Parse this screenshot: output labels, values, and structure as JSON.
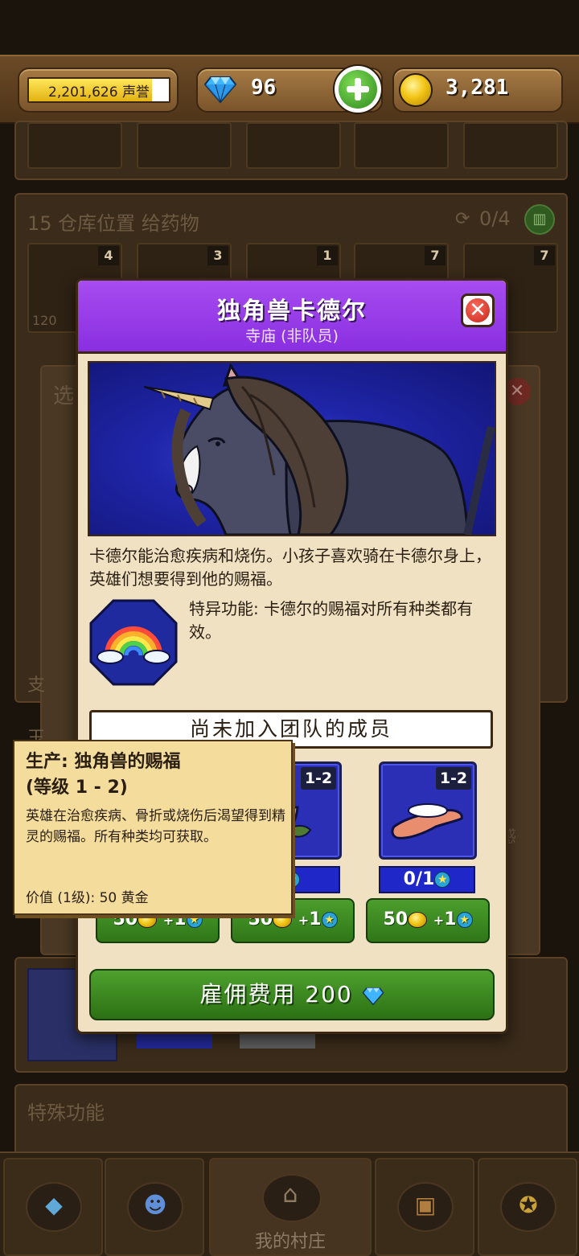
{
  "topbar": {
    "fame_value": "2,201,626 声誉",
    "fame_fill_fraction": 0.88,
    "gems": "96",
    "gold": "3,281"
  },
  "background": {
    "warehouse_title": "15 仓库位置 给药物",
    "warehouse_counter": "0/4",
    "slot_quantities": [
      "4",
      "3",
      "1",
      "7",
      "7"
    ],
    "price_fragment": "120",
    "selection_fragment": "选",
    "side_fragment_1": "支",
    "side_fragment_2": "玉",
    "right_fragment": "感",
    "special_title": "特殊功能",
    "nav_village": "我的村庄"
  },
  "modal": {
    "title": "独角兽卡德尔",
    "subtitle": "寺庙 (非队员)",
    "description": "卡德尔能治愈疾病和烧伤。小孩子喜欢骑在卡德尔身上，英雄们想要得到他的赐福。",
    "ability": "特异功能: 卡德尔的赐福对所有种类都有效。",
    "members_banner": "尚未加入团队的成员",
    "items": [
      {
        "level": "1-2",
        "count": "",
        "cost": "50",
        "cost_star": "1"
      },
      {
        "level": "1-2",
        "count": "",
        "cost": "50",
        "cost_star": "1"
      },
      {
        "level": "1-2",
        "count": "0/1",
        "cost": "50",
        "cost_star": "1"
      }
    ],
    "hire_label": "雇佣费用 200"
  },
  "tooltip": {
    "title_line1": "生产: 独角兽的赐福",
    "title_line2": "(等级 1 - 2)",
    "body": "英雄在治愈疾病、骨折或烧伤后渴望得到精灵的赐福。所有种类均可获取。",
    "value": "价值 (1级): 50 黄金"
  },
  "colors": {
    "modal_header": "#9a3ee8",
    "hire_button": "#3c8a22",
    "item_card": "#2a2fb6",
    "tooltip_bg": "#f3dc9c"
  },
  "icons": [
    "diamond-icon",
    "plus-icon",
    "gold-coin-icon",
    "close-icon",
    "rainbow-icon",
    "star-icon",
    "recycle-icon",
    "trash-icon",
    "home-icon",
    "heroes-icon",
    "chest-icon",
    "medal-icon"
  ]
}
